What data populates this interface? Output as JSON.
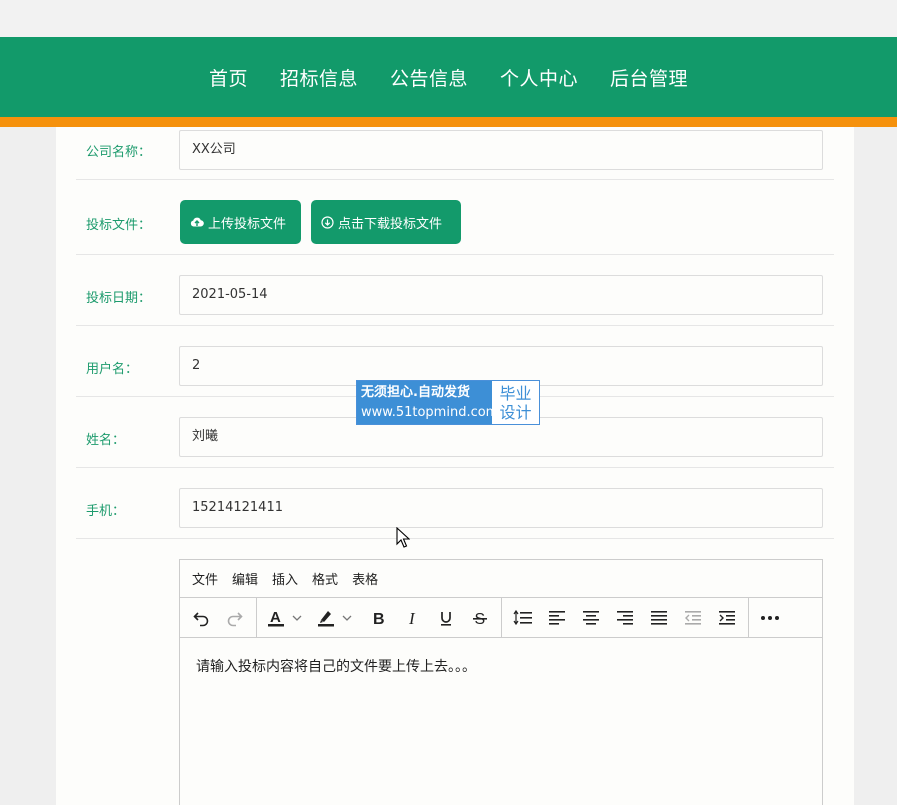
{
  "nav": {
    "items": [
      "首页",
      "招标信息",
      "公告信息",
      "个人中心",
      "后台管理"
    ]
  },
  "form": {
    "company": {
      "label": "公司名称：",
      "value": "XX公司"
    },
    "file": {
      "label": "投标文件：",
      "upload_label": "上传投标文件",
      "download_label": "点击下载投标文件"
    },
    "date": {
      "label": "投标日期：",
      "value": "2021-05-14"
    },
    "username": {
      "label": "用户名：",
      "value": "2"
    },
    "name": {
      "label": "姓名：",
      "value": "刘曦"
    },
    "phone": {
      "label": "手机：",
      "value": "15214121411"
    }
  },
  "watermark": {
    "line1": "无须担心.自动发货",
    "line2": "www.51topmind.com",
    "right1": "毕业",
    "right2": "设计"
  },
  "editor": {
    "menu": [
      "文件",
      "编辑",
      "插入",
      "格式",
      "表格"
    ],
    "content": "请输入投标内容将自己的文件要上传上去。。。"
  },
  "colors": {
    "nav_bg": "#129a6a",
    "accent_line": "#f5910c",
    "label": "#1d9b6d",
    "button": "#139a6b"
  }
}
